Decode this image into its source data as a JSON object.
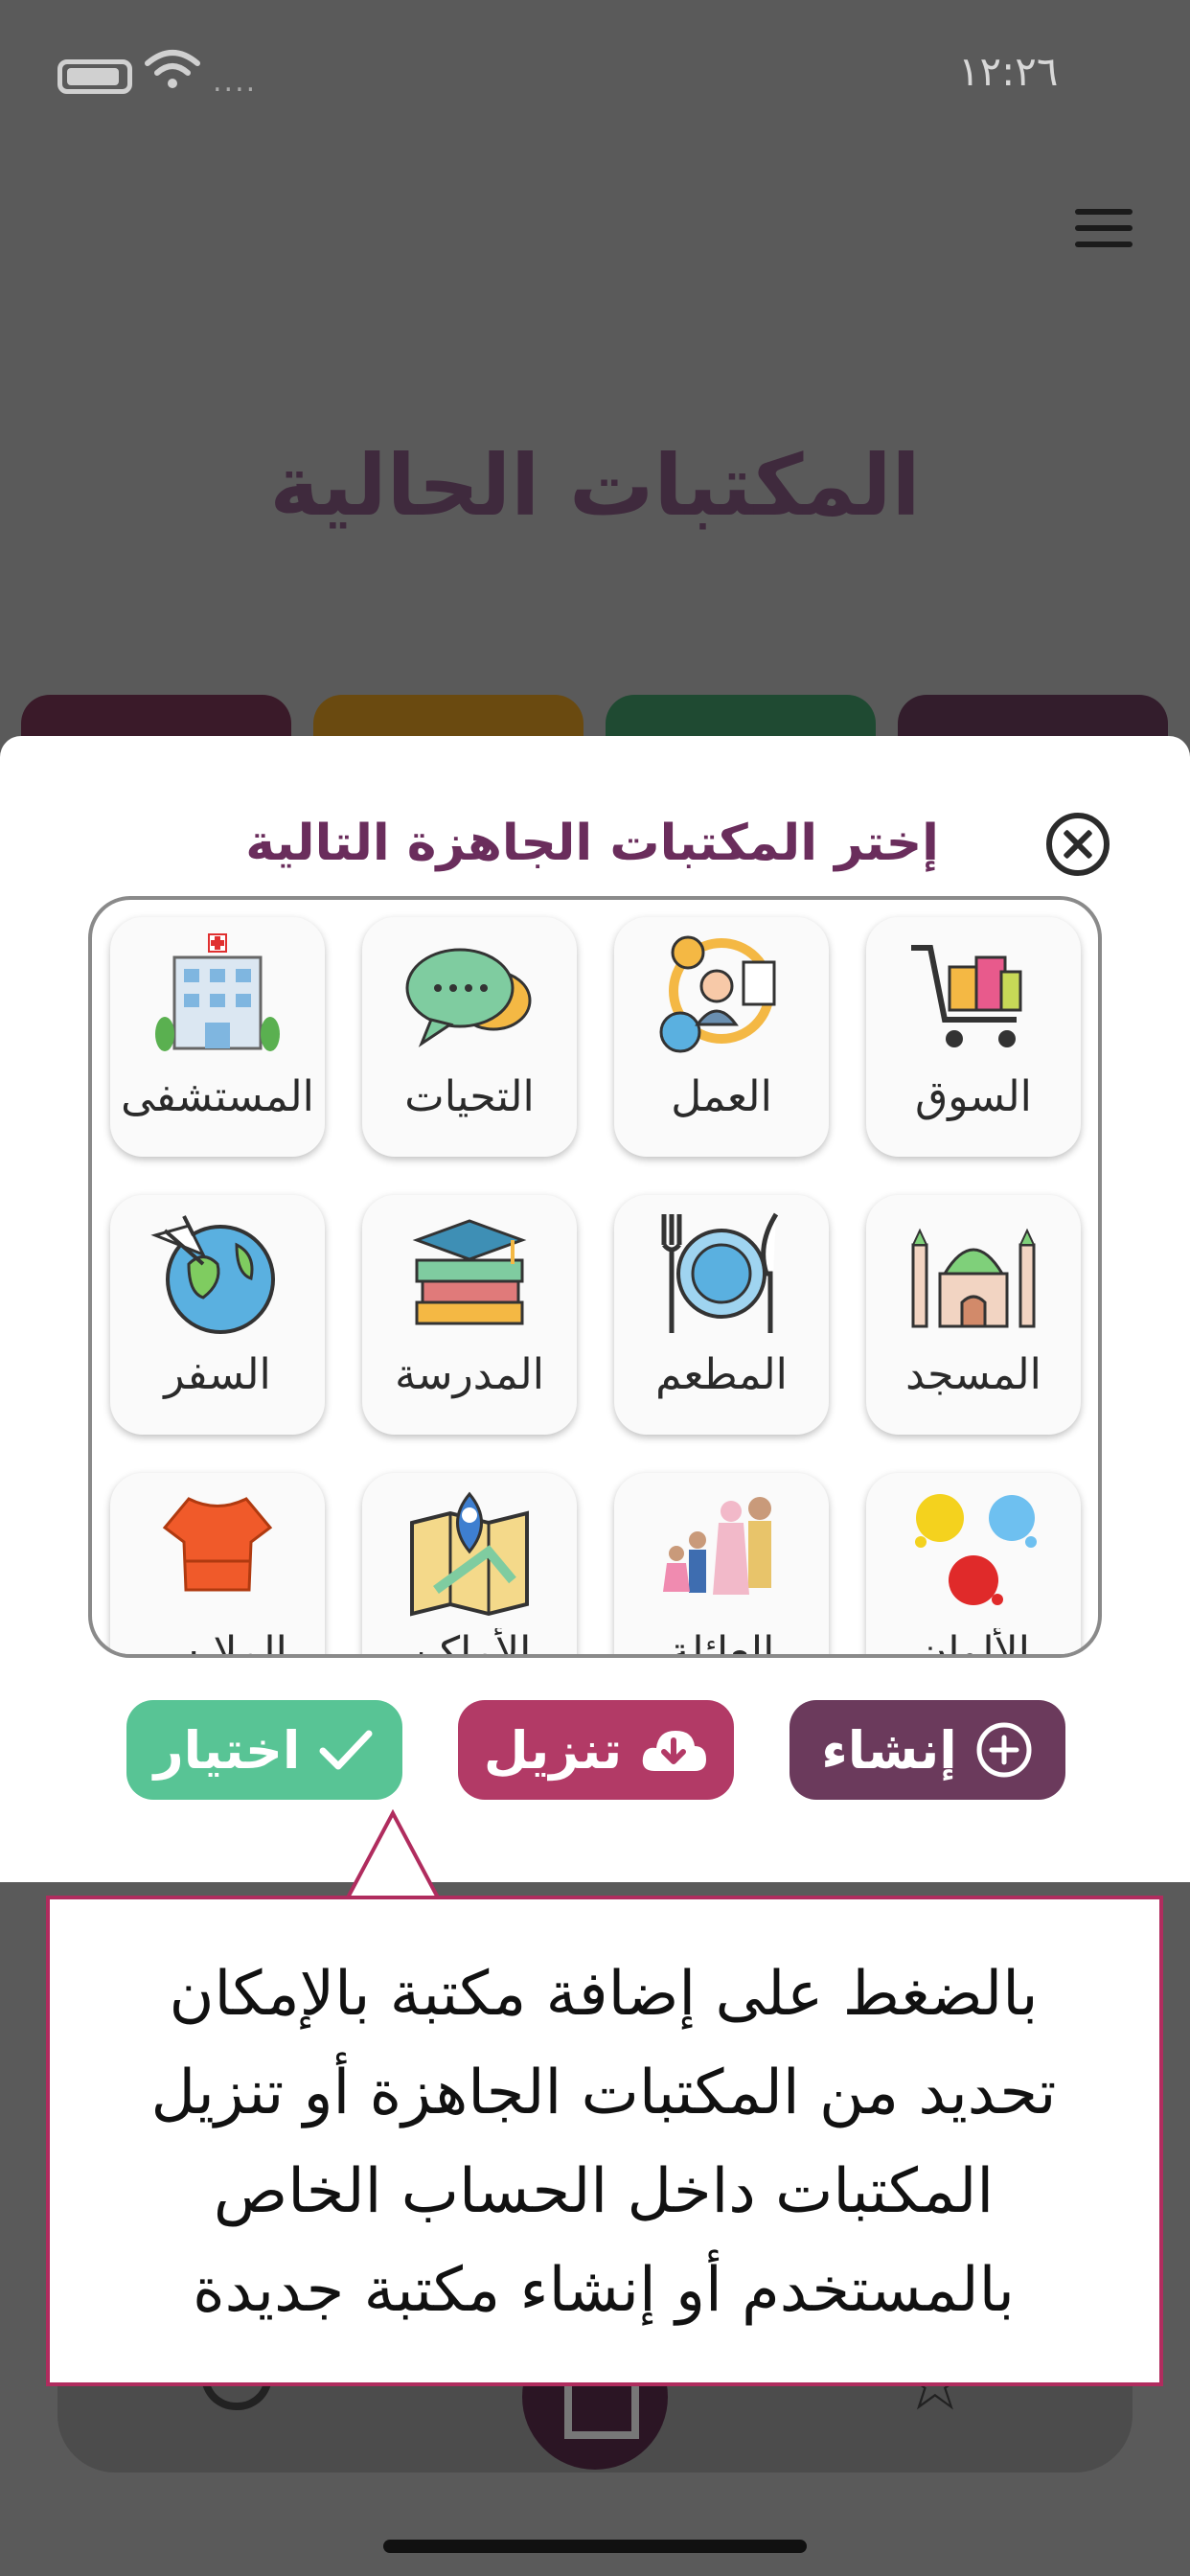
{
  "status_bar": {
    "time": "١٢:٢٦",
    "signal_dots": "....",
    "icons": [
      "battery-icon",
      "wifi-icon"
    ]
  },
  "header": {
    "menu_icon": "hamburger-menu-icon",
    "title": "المكتبات الحالية"
  },
  "modal": {
    "title": "إختر المكتبات الجاهزة التالية",
    "close_icon": "close-circle-icon",
    "libraries": [
      {
        "label": "السوق",
        "icon": "shopping-cart-icon"
      },
      {
        "label": "العمل",
        "icon": "work-gears-icon"
      },
      {
        "label": "التحيات",
        "icon": "speech-bubbles-icon"
      },
      {
        "label": "المستشفى",
        "icon": "hospital-icon"
      },
      {
        "label": "المسجد",
        "icon": "mosque-icon"
      },
      {
        "label": "المطعم",
        "icon": "plate-cutlery-icon"
      },
      {
        "label": "المدرسة",
        "icon": "books-graduation-icon"
      },
      {
        "label": "السفر",
        "icon": "globe-plane-icon"
      },
      {
        "label": "الألوان",
        "icon": "paint-splash-icon"
      },
      {
        "label": "العائلة",
        "icon": "family-icon"
      },
      {
        "label": "الأماكن",
        "icon": "map-pin-icon"
      },
      {
        "label": "الملابس",
        "icon": "dress-icon"
      }
    ],
    "buttons": {
      "create": {
        "label": "إنشاء",
        "icon": "plus-circle-icon",
        "color": "#6b3a5c"
      },
      "download": {
        "label": "تنزيل",
        "icon": "cloud-download-icon",
        "color": "#b23a66"
      },
      "select": {
        "label": "اختيار",
        "icon": "checkmark-icon",
        "color": "#58c495"
      }
    }
  },
  "tooltip": {
    "lines": [
      "بالضغط على إضافة مكتبة بالإمكان",
      "تحديد من المكتبات الجاهزة أو تنزيل",
      "المكتبات داخل الحساب الخاص",
      "بالمستخدم أو إنشاء مكتبة جديدة"
    ],
    "border_color": "#b02c5e"
  },
  "bottom_nav": {
    "icons": [
      "bell-icon",
      "home-icon",
      "star-icon"
    ]
  }
}
